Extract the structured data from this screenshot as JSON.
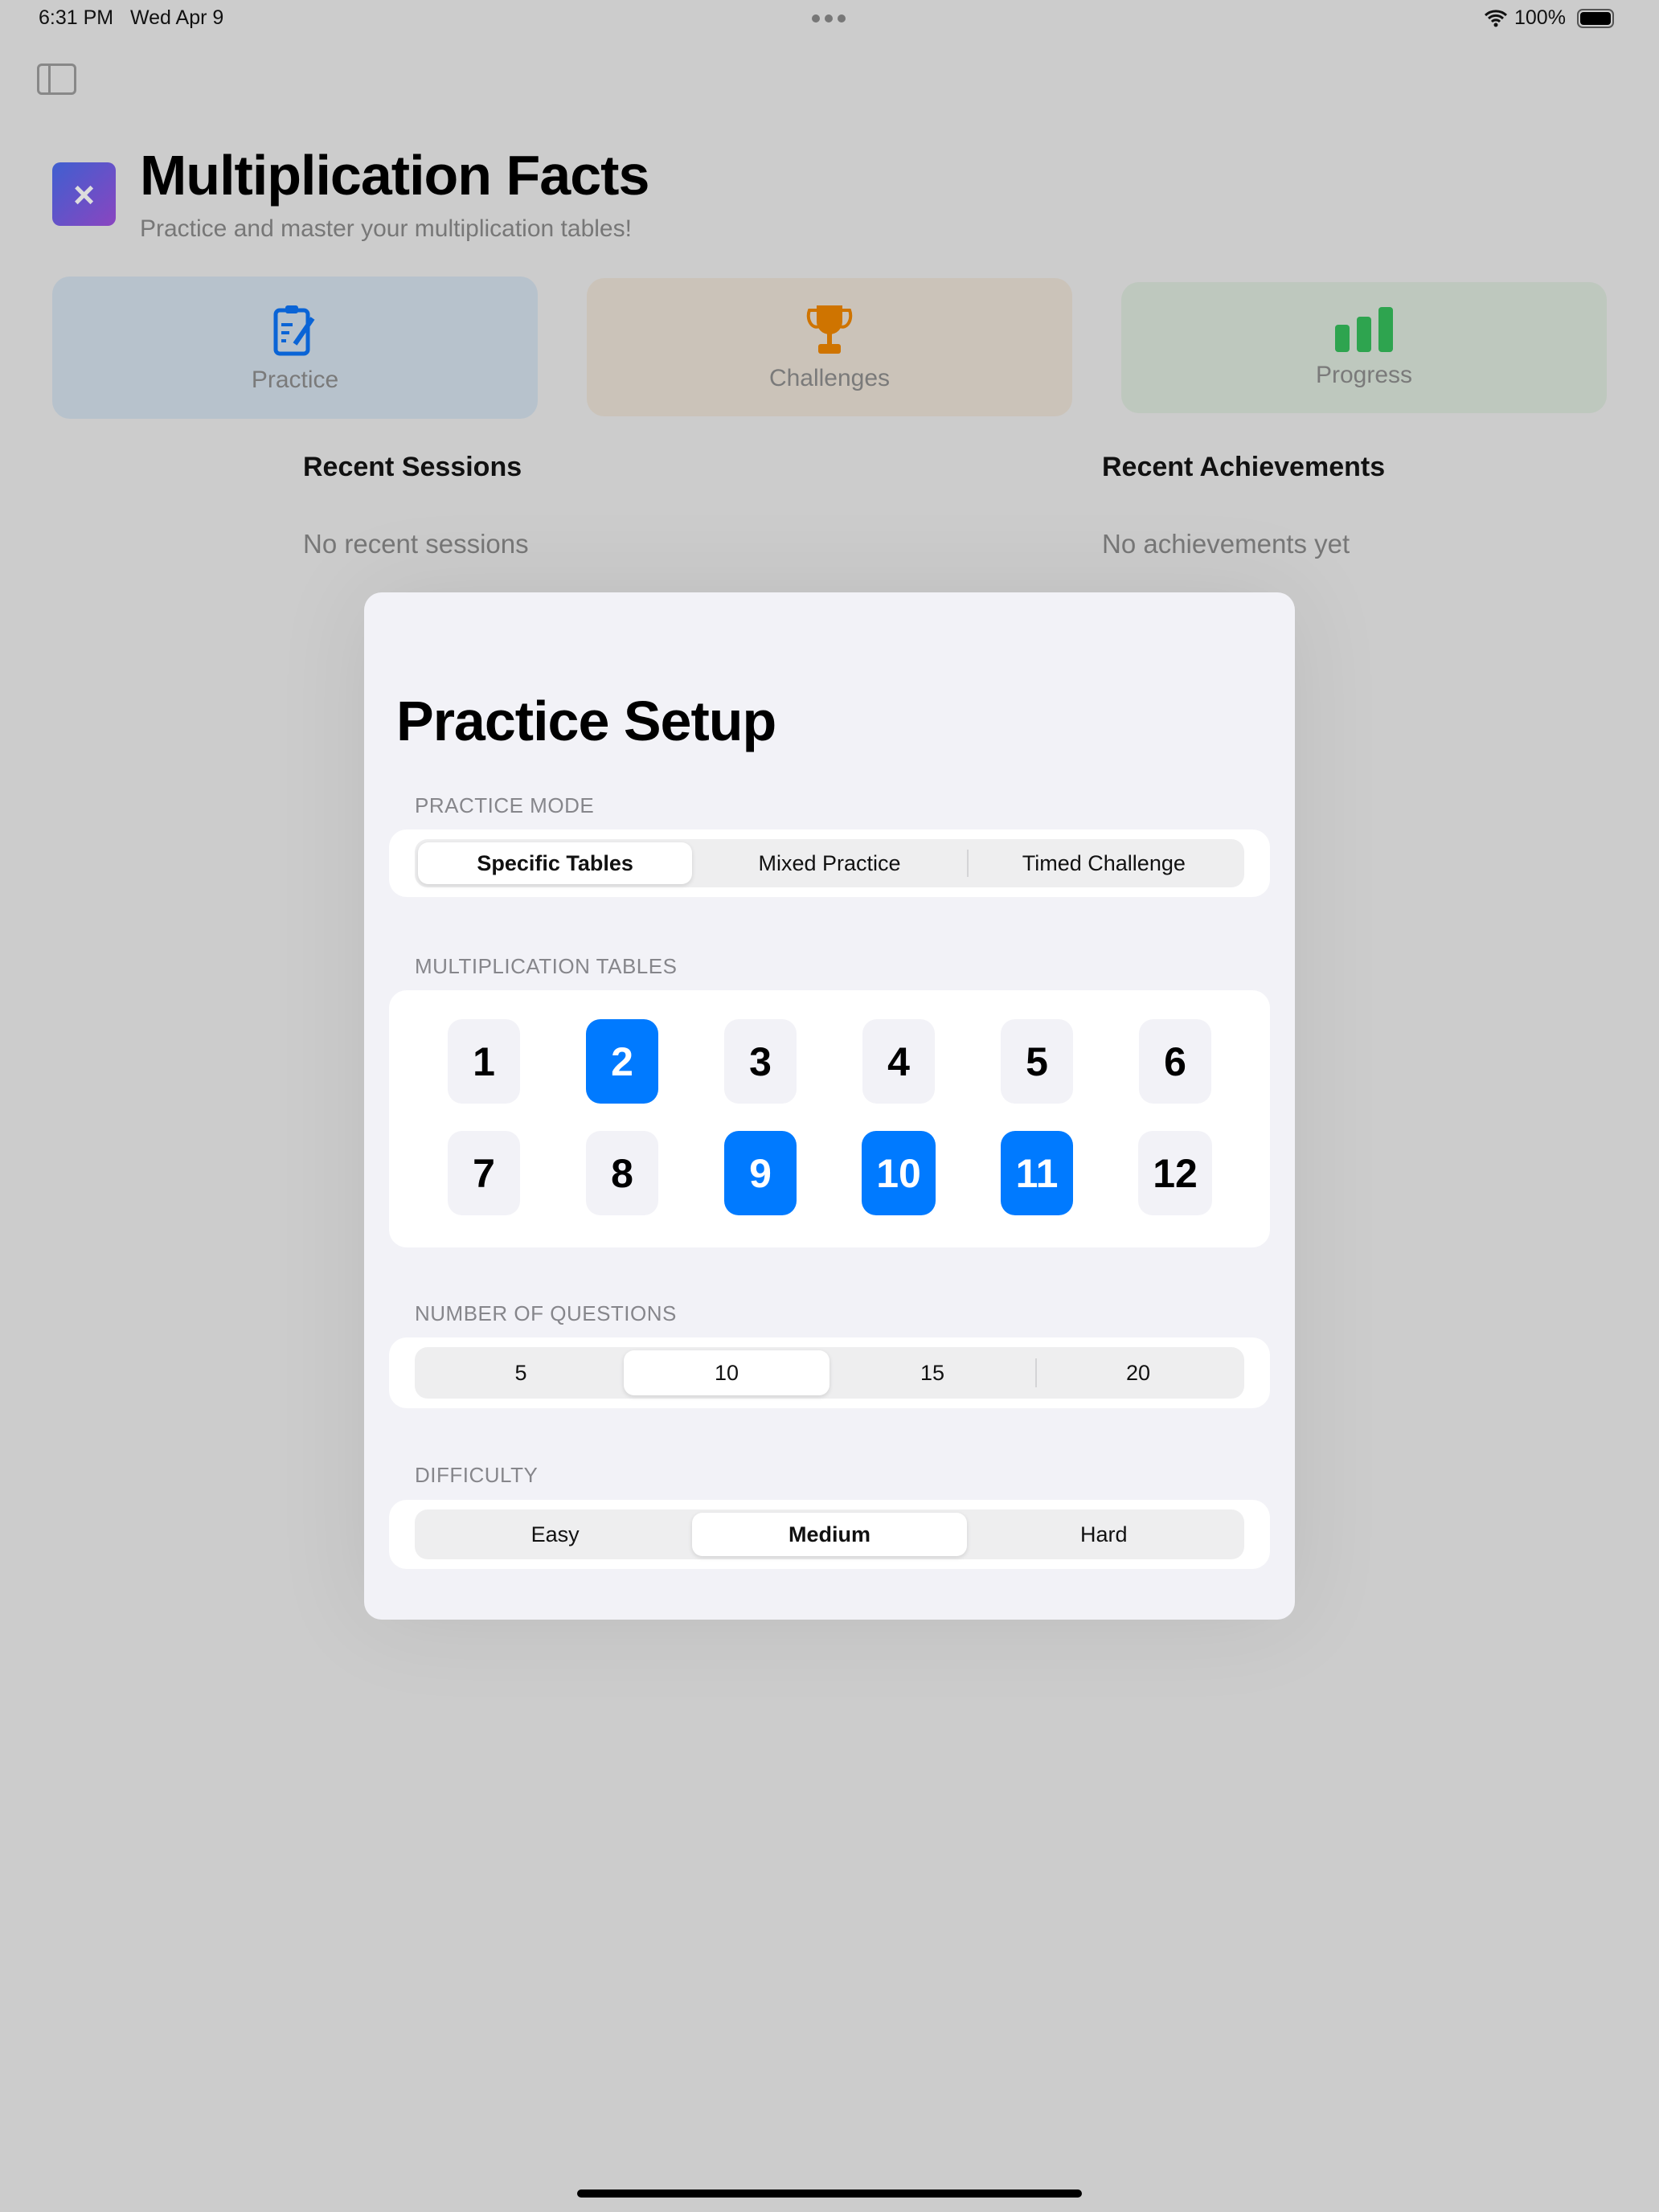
{
  "status_bar": {
    "time": "6:31 PM",
    "date": "Wed Apr 9",
    "battery": "100%"
  },
  "header": {
    "title": "Multiplication Facts",
    "subtitle": "Practice and master your multiplication tables!"
  },
  "cards": [
    {
      "label": "Practice",
      "icon": "clipboard-pencil-icon",
      "color": "#0a64d6"
    },
    {
      "label": "Challenges",
      "icon": "trophy-icon",
      "color": "#cf7400"
    },
    {
      "label": "Progress",
      "icon": "bar-chart-icon",
      "color": "#2ea44f"
    }
  ],
  "recent_sessions": {
    "title": "Recent Sessions",
    "empty": "No recent sessions"
  },
  "recent_achievements": {
    "title": "Recent Achievements",
    "empty": "No achievements yet"
  },
  "modal": {
    "title": "Practice Setup",
    "practice_mode": {
      "label": "PRACTICE MODE",
      "options": [
        "Specific Tables",
        "Mixed Practice",
        "Timed Challenge"
      ],
      "selected": 0
    },
    "tables": {
      "label": "MULTIPLICATION TABLES",
      "items": [
        "1",
        "2",
        "3",
        "4",
        "5",
        "6",
        "7",
        "8",
        "9",
        "10",
        "11",
        "12"
      ],
      "selected": [
        "2",
        "9",
        "10",
        "11"
      ]
    },
    "questions": {
      "label": "NUMBER OF QUESTIONS",
      "options": [
        "5",
        "10",
        "15",
        "20"
      ],
      "selected": 1
    },
    "difficulty": {
      "label": "DIFFICULTY",
      "options": [
        "Easy",
        "Medium",
        "Hard"
      ],
      "selected": 1
    }
  },
  "colors": {
    "accent": "#007aff"
  }
}
